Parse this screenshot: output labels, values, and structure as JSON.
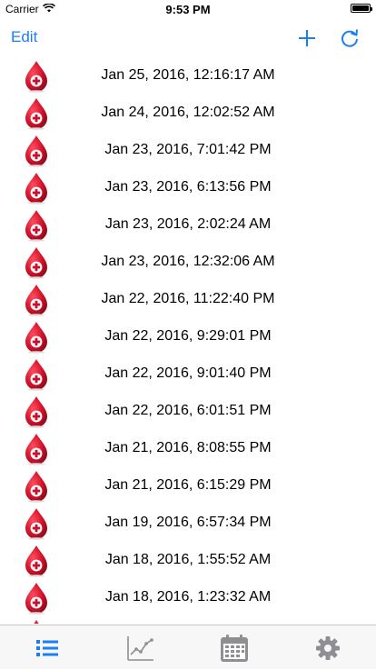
{
  "status_bar": {
    "carrier": "Carrier",
    "time": "9:53 PM"
  },
  "nav": {
    "edit_label": "Edit",
    "add_icon": "plus-icon",
    "refresh_icon": "refresh-icon"
  },
  "entries": [
    "Jan 25, 2016, 12:16:17 AM",
    "Jan 24, 2016, 12:02:52 AM",
    "Jan 23, 2016, 7:01:42 PM",
    "Jan 23, 2016, 6:13:56 PM",
    "Jan 23, 2016, 2:02:24 AM",
    "Jan 23, 2016, 12:32:06 AM",
    "Jan 22, 2016, 11:22:40 PM",
    "Jan 22, 2016, 9:29:01 PM",
    "Jan 22, 2016, 9:01:40 PM",
    "Jan 22, 2016, 6:01:51 PM",
    "Jan 21, 2016, 8:08:55 PM",
    "Jan 21, 2016, 6:15:29 PM",
    "Jan 19, 2016, 6:57:34 PM",
    "Jan 18, 2016, 1:55:52 AM",
    "Jan 18, 2016, 1:23:32 AM",
    ""
  ],
  "tabs": [
    {
      "icon": "list-icon",
      "active": true
    },
    {
      "icon": "chart-icon",
      "active": false
    },
    {
      "icon": "calendar-icon",
      "active": false
    },
    {
      "icon": "gear-icon",
      "active": false
    }
  ],
  "colors": {
    "accent": "#1a7ef5",
    "drop_red": "#c8102e",
    "tab_inactive": "#8e8e93"
  }
}
